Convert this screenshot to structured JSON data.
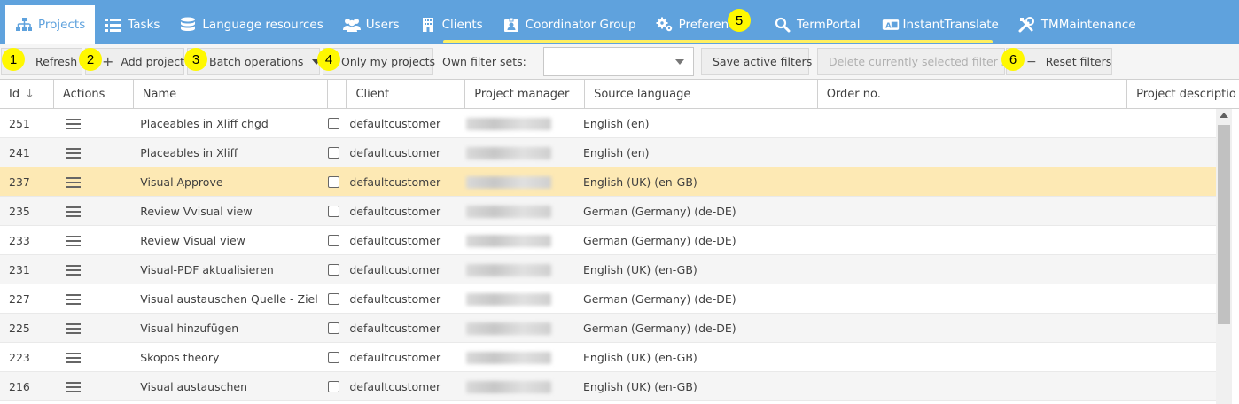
{
  "nav": {
    "tabs": [
      {
        "label": "Projects",
        "icon": "sitemap-icon",
        "active": true
      },
      {
        "label": "Tasks",
        "icon": "list-icon"
      },
      {
        "label": "Language resources",
        "icon": "database-icon"
      },
      {
        "label": "Users",
        "icon": "users-icon"
      },
      {
        "label": "Clients",
        "icon": "building-icon"
      },
      {
        "label": "Coordinator Group",
        "icon": "badge-icon"
      },
      {
        "label": "Preferences",
        "icon": "gears-icon"
      },
      {
        "label": "TermPortal",
        "icon": "search-icon"
      },
      {
        "label": "InstantTranslate",
        "icon": "translate-icon"
      },
      {
        "label": "TMMaintenance",
        "icon": "tools-icon"
      }
    ]
  },
  "toolbar": {
    "refresh": "Refresh",
    "add_project": "Add project",
    "batch_operations": "Batch operations",
    "only_my_projects": "Only my projects",
    "own_filter_sets": "Own filter sets:",
    "filter_value": "",
    "save_active_filters": "Save active filters",
    "delete_filter_set": "Delete currently selected filter set",
    "reset_filters": "Reset filters"
  },
  "markers": [
    "1",
    "2",
    "3",
    "4",
    "5",
    "6"
  ],
  "grid": {
    "columns": [
      "Id",
      "Actions",
      "Name",
      "",
      "Client",
      "Project manager",
      "Source language",
      "Order no.",
      "Project descriptio"
    ],
    "sort_indicator": "↓",
    "rows": [
      {
        "id": "251",
        "name": "Placeables in Xliff chgd",
        "client": "defaultcustomer",
        "source": "English (en)"
      },
      {
        "id": "241",
        "name": "Placeables in Xliff",
        "client": "defaultcustomer",
        "source": "English (en)"
      },
      {
        "id": "237",
        "name": "Visual Approve",
        "client": "defaultcustomer",
        "source": "English (UK) (en-GB)",
        "selected": true
      },
      {
        "id": "235",
        "name": "Review Vvisual view",
        "client": "defaultcustomer",
        "source": "German (Germany) (de-DE)"
      },
      {
        "id": "233",
        "name": "Review Visual view",
        "client": "defaultcustomer",
        "source": "German (Germany) (de-DE)"
      },
      {
        "id": "231",
        "name": "Visual-PDF aktualisieren",
        "client": "defaultcustomer",
        "source": "English (UK) (en-GB)"
      },
      {
        "id": "227",
        "name": "Visual austauschen Quelle - Ziel",
        "client": "defaultcustomer",
        "source": "German (Germany) (de-DE)"
      },
      {
        "id": "225",
        "name": "Visual hinzufügen",
        "client": "defaultcustomer",
        "source": "German (Germany) (de-DE)"
      },
      {
        "id": "223",
        "name": "Skopos theory",
        "client": "defaultcustomer",
        "source": "English (UK) (en-GB)"
      },
      {
        "id": "216",
        "name": "Visual austauschen",
        "client": "defaultcustomer",
        "source": "English (UK) (en-GB)"
      }
    ]
  },
  "colors": {
    "nav_bg": "#5fa2dd",
    "selected_row": "#fde9b4",
    "marker": "#fff800"
  }
}
